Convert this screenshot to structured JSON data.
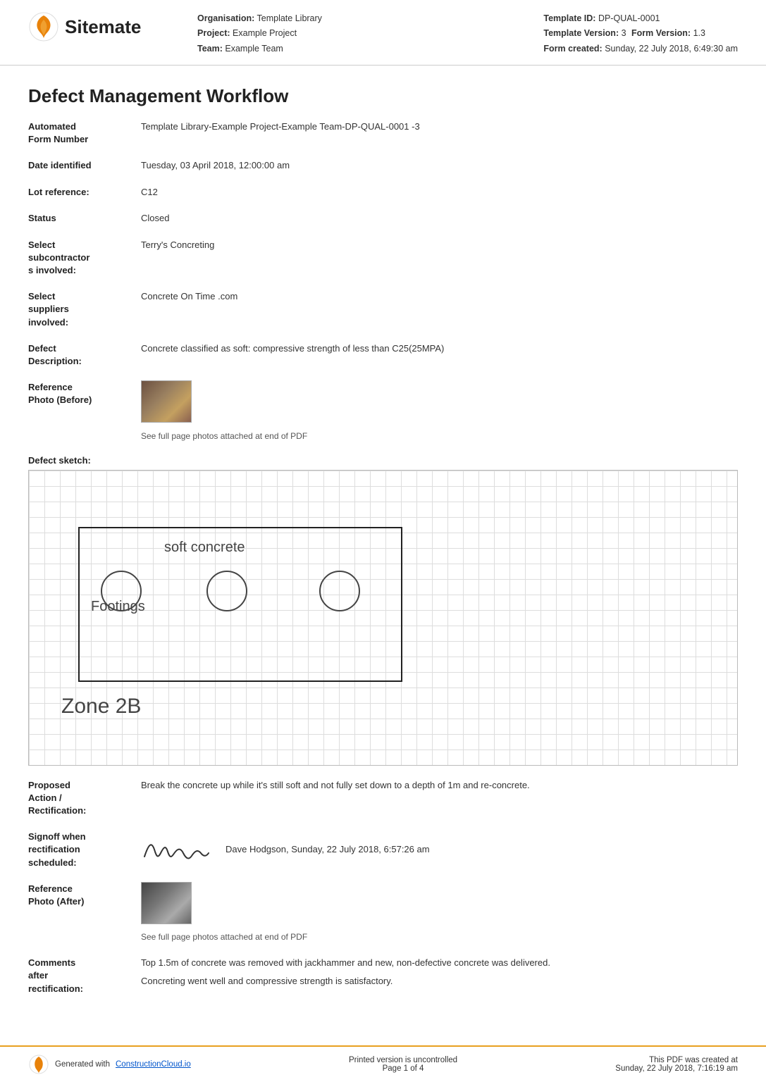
{
  "header": {
    "logo_text": "Sitemate",
    "org_label": "Organisation:",
    "org_value": "Template Library",
    "project_label": "Project:",
    "project_value": "Example Project",
    "team_label": "Team:",
    "team_value": "Example Team",
    "template_id_label": "Template ID:",
    "template_id_value": "DP-QUAL-0001",
    "template_version_label": "Template Version:",
    "template_version_value": "3",
    "form_version_label": "Form Version:",
    "form_version_value": "1.3",
    "form_created_label": "Form created:",
    "form_created_value": "Sunday, 22 July 2018, 6:49:30 am"
  },
  "form": {
    "title": "Defect Management Workflow",
    "fields": [
      {
        "label": "Automated\nForm Number",
        "value": "Template Library-Example Project-Example Team-DP-QUAL-0001  -3"
      },
      {
        "label": "Date identified",
        "value": "Tuesday, 03 April 2018, 12:00:00 am"
      },
      {
        "label": "Lot reference:",
        "value": "C12"
      },
      {
        "label": "Status",
        "value": "Closed"
      },
      {
        "label": "Select\nsubcontractor\ns involved:",
        "value": "Terry's Concreting"
      },
      {
        "label": "Select\nsuppliers\ninvolved:",
        "value": "Concrete On Time .com"
      },
      {
        "label": "Defect\nDescription:",
        "value": "Concrete classified as soft: compressive strength of less than C25(25MPA)"
      }
    ],
    "reference_photo_before_label": "Reference\nPhoto (Before)",
    "reference_photo_caption": "See full page photos attached at end of PDF",
    "defect_sketch_label": "Defect sketch:",
    "sketch_text_soft": "soft concrete",
    "sketch_text_footings": "Footings",
    "sketch_text_zone": "Zone 2B",
    "proposed_action_label": "Proposed\nAction /\nRectification:",
    "proposed_action_value": "Break the concrete up while it's still soft and not fully set down to a depth of 1m and re-concrete.",
    "signoff_label": "Signoff when\nrectification\nscheduled:",
    "signoff_person": "Dave Hodgson, Sunday, 22 July 2018, 6:57:26 am",
    "reference_photo_after_label": "Reference\nPhoto (After)",
    "reference_photo_after_caption": "See full page photos attached at end of PDF",
    "comments_label": "Comments\nafter\nrectification:",
    "comments_value1": "Top 1.5m of concrete was removed with jackhammer and new, non-defective concrete was delivered.",
    "comments_value2": "Concreting went well and compressive strength is satisfactory."
  },
  "footer": {
    "generated_text": "Generated with",
    "link_text": "ConstructionCloud.io",
    "center_line1": "Printed version is uncontrolled",
    "center_line2": "Page 1 of 4",
    "right_line1": "This PDF was created at",
    "right_line2": "Sunday, 22 July 2018, 7:16:19 am"
  }
}
